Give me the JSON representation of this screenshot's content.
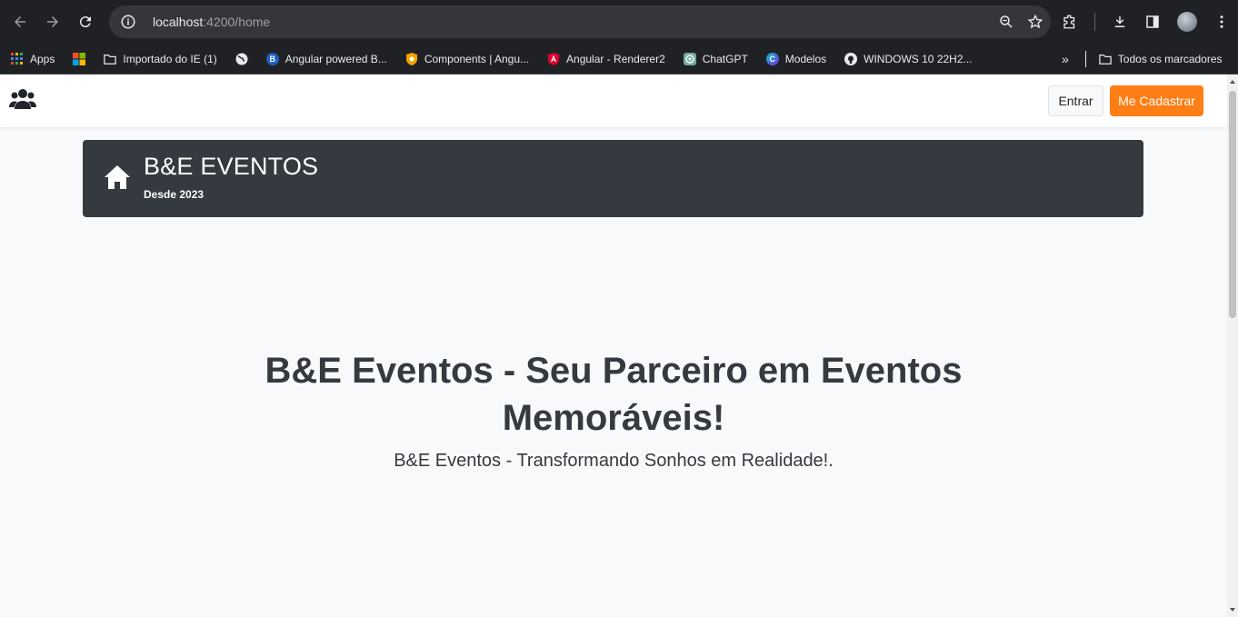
{
  "browser": {
    "url_host": "localhost",
    "url_path": ":4200/home"
  },
  "bookmarks": [
    {
      "label": "Apps",
      "icon": "apps-grid-icon",
      "color": "#4285f4"
    },
    {
      "label": "",
      "icon": "microsoft-logo-icon",
      "color": "#f25022"
    },
    {
      "label": "Importado do IE (1)",
      "icon": "folder-icon",
      "color": "#e8eaed"
    },
    {
      "label": "",
      "icon": "globe-icon",
      "color": "#e8eaed"
    },
    {
      "label": "Angular powered B...",
      "icon": "bootstrap-b-icon",
      "color": "#1f5fbf"
    },
    {
      "label": "Components | Angu...",
      "icon": "shield-icon",
      "color": "#f4a300"
    },
    {
      "label": "Angular - Renderer2",
      "icon": "angular-icon",
      "color": "#dd0031"
    },
    {
      "label": "ChatGPT",
      "icon": "chatgpt-icon",
      "color": "#74aa9c"
    },
    {
      "label": "Modelos",
      "icon": "canva-icon",
      "color": "#7d2ae8"
    },
    {
      "label": "WINDOWS 10 22H2...",
      "icon": "github-icon",
      "color": "#e8eaed"
    }
  ],
  "bookmarks_folder": "Todos os marcadores",
  "navbar": {
    "login_label": "Entrar",
    "signup_label": "Me Cadastrar",
    "signup_color": "#fd7e14"
  },
  "banner": {
    "title": "B&E EVENTOS",
    "subtitle": "Desde 2023"
  },
  "hero": {
    "title": "B&E Eventos - Seu Parceiro em Eventos Memoráveis!",
    "subtitle": "B&E Eventos - Transformando Sonhos em Realidade!."
  }
}
